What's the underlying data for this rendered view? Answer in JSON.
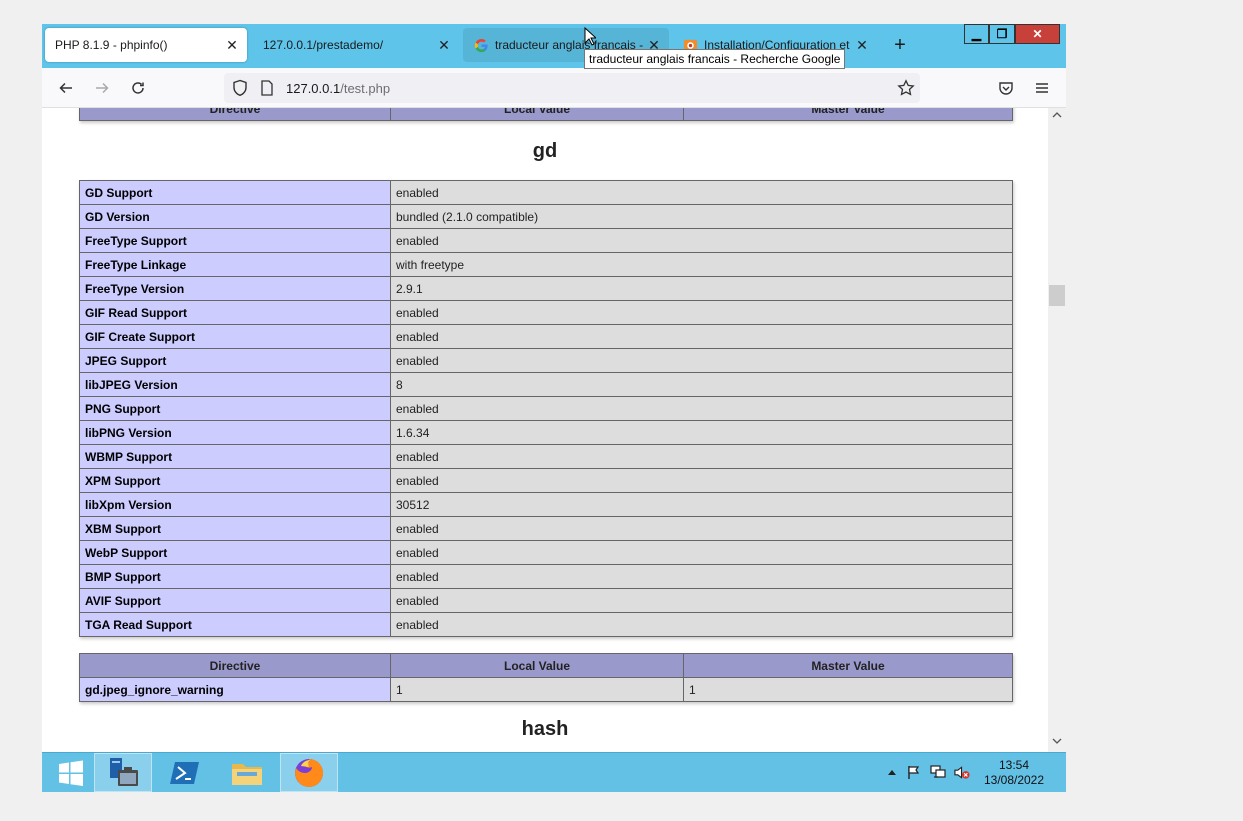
{
  "tabs": [
    {
      "label": "PHP 8.1.9 - phpinfo()",
      "close": "✕"
    },
    {
      "label": "127.0.0.1/prestademo/",
      "close": "✕"
    },
    {
      "label": "traducteur anglais francais -",
      "close": "✕"
    },
    {
      "label": "Installation/Configuration et",
      "close": "✕"
    }
  ],
  "new_tab": "+",
  "window_controls": {
    "minimize": "▁",
    "maximize": "❐",
    "close": "✕"
  },
  "tooltip": "traducteur anglais francais - Recherche Google",
  "url": {
    "host": "127.0.0.1",
    "path": "/test.php"
  },
  "page": {
    "top_header": {
      "directive": "Directive",
      "local": "Local Value",
      "master": "Master Value"
    },
    "gd_title": "gd",
    "gd_rows": [
      {
        "name": "GD Support",
        "value": "enabled"
      },
      {
        "name": "GD Version",
        "value": "bundled (2.1.0 compatible)"
      },
      {
        "name": "FreeType Support",
        "value": "enabled"
      },
      {
        "name": "FreeType Linkage",
        "value": "with freetype"
      },
      {
        "name": "FreeType Version",
        "value": "2.9.1"
      },
      {
        "name": "GIF Read Support",
        "value": "enabled"
      },
      {
        "name": "GIF Create Support",
        "value": "enabled"
      },
      {
        "name": "JPEG Support",
        "value": "enabled"
      },
      {
        "name": "libJPEG Version",
        "value": "8"
      },
      {
        "name": "PNG Support",
        "value": "enabled"
      },
      {
        "name": "libPNG Version",
        "value": "1.6.34"
      },
      {
        "name": "WBMP Support",
        "value": "enabled"
      },
      {
        "name": "XPM Support",
        "value": "enabled"
      },
      {
        "name": "libXpm Version",
        "value": "30512"
      },
      {
        "name": "XBM Support",
        "value": "enabled"
      },
      {
        "name": "WebP Support",
        "value": "enabled"
      },
      {
        "name": "BMP Support",
        "value": "enabled"
      },
      {
        "name": "AVIF Support",
        "value": "enabled"
      },
      {
        "name": "TGA Read Support",
        "value": "enabled"
      }
    ],
    "directive_header": {
      "directive": "Directive",
      "local": "Local Value",
      "master": "Master Value"
    },
    "directive_rows": [
      {
        "name": "gd.jpeg_ignore_warning",
        "local": "1",
        "master": "1"
      }
    ],
    "hash_title": "hash"
  },
  "clock": {
    "time": "13:54",
    "date": "13/08/2022"
  },
  "colors": {
    "tabstrip": "#5ec4ea",
    "taskbar": "#63c1e6",
    "row_name": "#ccccff",
    "row_value": "#dddddd",
    "header": "#9999cc"
  }
}
